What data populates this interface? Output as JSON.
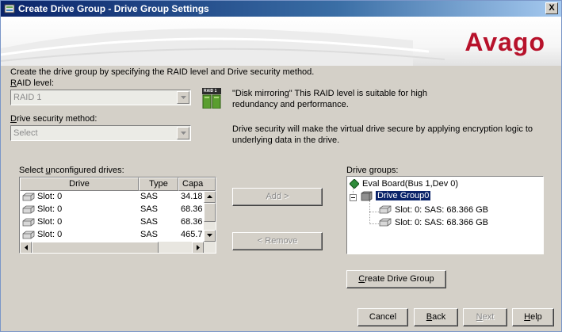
{
  "window": {
    "title": "Create Drive Group - Drive Group Settings",
    "close_label": "X"
  },
  "banner": {
    "logo_text": "Avago"
  },
  "intro": "Create the drive group by specifying the RAID level and Drive security method.",
  "raid": {
    "label_u": "R",
    "label_rest": "AID level:",
    "value": "RAID 1",
    "icon_text": "RAID 1",
    "description": "\"Disk mirroring\" This RAID level is suitable for high redundancy and performance."
  },
  "security": {
    "label_u": "D",
    "label_rest": "rive security method:",
    "value": "Select",
    "description": "Drive security will make the virtual drive secure by applying encryption logic to underlying data in the drive."
  },
  "unconfigured": {
    "label_pre": "Select ",
    "label_u": "u",
    "label_rest": "nconfigured drives:",
    "columns": [
      "Drive",
      "Type",
      "Capa"
    ],
    "rows": [
      {
        "drive": "Slot: 0",
        "type": "SAS",
        "capacity": "34.18"
      },
      {
        "drive": "Slot: 0",
        "type": "SAS",
        "capacity": "68.36"
      },
      {
        "drive": "Slot: 0",
        "type": "SAS",
        "capacity": "68.36"
      },
      {
        "drive": "Slot: 0",
        "type": "SAS",
        "capacity": "465.7"
      }
    ]
  },
  "actions": {
    "add_label": "Add >",
    "remove_label": "< Remove"
  },
  "drive_groups": {
    "label": "Drive groups:",
    "root": "Eval Board(Bus 1,Dev 0)",
    "group": "Drive Group0",
    "members": [
      "Slot: 0: SAS: 68.366 GB",
      "Slot: 0: SAS: 68.366 GB"
    ],
    "create_label_u": "C",
    "create_label_rest": "reate Drive Group"
  },
  "footer": {
    "cancel": "Cancel",
    "back_u": "B",
    "back_rest": "ack",
    "next_u": "N",
    "next_rest": "ext",
    "help_u": "H",
    "help_rest": "elp"
  },
  "colors": {
    "title_bar": "#0a246a",
    "logo": "#b7122b",
    "selection": "#0a246a",
    "dialog_bg": "#d4d0c8"
  },
  "icons": {
    "title": "app-icon",
    "raid": "raid1-icon",
    "drive": "disk-drive-icon",
    "controller": "controller-diamond-icon",
    "group": "drive-group-icon"
  }
}
